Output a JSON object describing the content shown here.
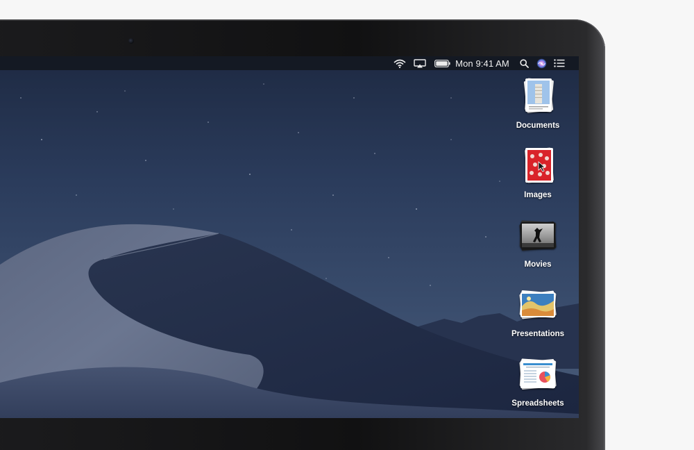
{
  "menubar": {
    "clock": "Mon 9:41 AM",
    "icons": [
      "wifi-icon",
      "airplay-icon",
      "battery-icon",
      "spotlight-search-icon",
      "siri-icon",
      "notification-center-icon"
    ]
  },
  "desktop": {
    "stacks": [
      {
        "label": "Documents",
        "icon": "documents-stack-icon"
      },
      {
        "label": "Images",
        "icon": "images-stack-icon"
      },
      {
        "label": "Movies",
        "icon": "movies-stack-icon"
      },
      {
        "label": "Presentations",
        "icon": "presentations-stack-icon"
      },
      {
        "label": "Spreadsheets",
        "icon": "spreadsheets-stack-icon"
      }
    ]
  },
  "colors": {
    "menubar_bg": "#14181f",
    "sky_top": "#1f2c46",
    "dune_light": "#6d7890",
    "bezel": "#111112"
  }
}
